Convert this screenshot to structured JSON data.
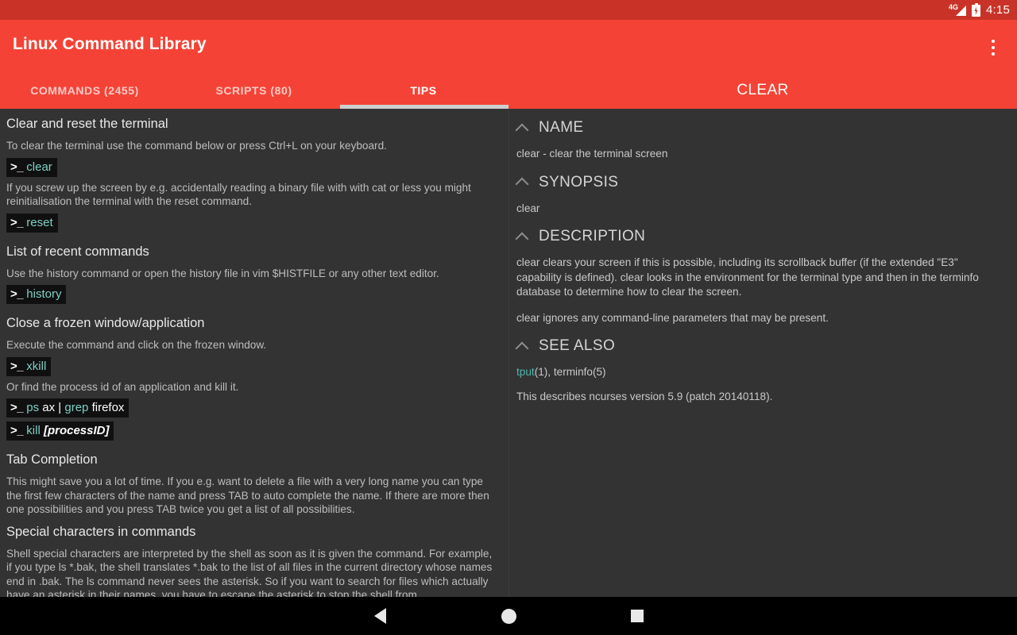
{
  "status_bar": {
    "network_label": "4G",
    "network_icon": "signal-triangle-icon",
    "battery_icon": "battery-charging-icon",
    "time": "4:15"
  },
  "app_bar": {
    "title": "Linux Command Library",
    "overflow_icon": "overflow-menu-icon",
    "background_color": "#f44336"
  },
  "tabs": [
    {
      "label": "COMMANDS (2455)",
      "active": false
    },
    {
      "label": "SCRIPTS (80)",
      "active": false
    },
    {
      "label": "TIPS",
      "active": true
    }
  ],
  "detail_pane_title": "CLEAR",
  "tips": [
    {
      "title": "Clear and reset the terminal",
      "blocks": [
        {
          "type": "text",
          "text": "To clear the terminal use the command below or press Ctrl+L on your keyboard."
        },
        {
          "type": "command",
          "prompt": ">_",
          "parts": [
            {
              "t": "clear",
              "style": "kw"
            }
          ]
        },
        {
          "type": "text",
          "text": "If you screw up the screen by e.g. accidentally reading a binary file with with cat or less you might reinitialisation the terminal with the reset command."
        },
        {
          "type": "command",
          "prompt": ">_",
          "parts": [
            {
              "t": "reset",
              "style": "kw"
            }
          ]
        }
      ]
    },
    {
      "title": "List of recent commands",
      "blocks": [
        {
          "type": "text",
          "text": "Use the history command or open the history file in vim $HISTFILE or any other text editor."
        },
        {
          "type": "command",
          "prompt": ">_",
          "parts": [
            {
              "t": "history",
              "style": "kw"
            }
          ]
        }
      ]
    },
    {
      "title": "Close a frozen window/application",
      "blocks": [
        {
          "type": "text",
          "text": "Execute the command and click on the frozen window."
        },
        {
          "type": "command",
          "prompt": ">_",
          "parts": [
            {
              "t": "xkill",
              "style": "kw"
            }
          ]
        },
        {
          "type": "text",
          "text": "Or find the process id of an application and kill it."
        },
        {
          "type": "command",
          "prompt": ">_",
          "parts": [
            {
              "t": "ps",
              "style": "kw"
            },
            {
              "t": " ax | ",
              "style": "arg"
            },
            {
              "t": "grep",
              "style": "kw"
            },
            {
              "t": " firefox",
              "style": "arg"
            }
          ]
        },
        {
          "type": "command",
          "prompt": ">_",
          "parts": [
            {
              "t": "kill",
              "style": "kw"
            },
            {
              "t": " ",
              "style": "arg"
            },
            {
              "t": "[processID]",
              "style": "ital"
            }
          ]
        }
      ]
    },
    {
      "title": "Tab Completion",
      "blocks": [
        {
          "type": "text",
          "text": "This might save you a lot of time. If you e.g. want to delete a file with a very long name you can type the first few characters of the name and press TAB to auto complete the name. If there are more then one possibilities and you press TAB twice you get a list of all possibilities."
        }
      ]
    },
    {
      "title": "Special characters in commands",
      "blocks": [
        {
          "type": "text",
          "text": "Shell special characters are interpreted by the shell as soon as it is given the command. For example, if you type ls *.bak, the shell translates *.bak to the list of all files in the current directory whose names end in .bak. The ls command never sees the asterisk. So if you want to search for files which actually have an asterisk in their names, you have to escape the asterisk to stop the shell from"
        }
      ]
    }
  ],
  "detail_sections": [
    {
      "heading": "NAME",
      "caret_icon": "chevron-up-icon",
      "paragraphs": [
        "clear - clear the terminal screen"
      ]
    },
    {
      "heading": "SYNOPSIS",
      "caret_icon": "chevron-up-icon",
      "paragraphs": [
        "clear"
      ]
    },
    {
      "heading": "DESCRIPTION",
      "caret_icon": "chevron-up-icon",
      "paragraphs": [
        "clear clears your screen if this is possible, including its scrollback buffer (if the extended \"E3\" capability is defined). clear looks in the environment for the terminal type and then in the terminfo database to determine how to clear the screen.",
        "clear ignores any command-line parameters that may be present."
      ]
    },
    {
      "heading": "SEE ALSO",
      "caret_icon": "chevron-up-icon",
      "see_also": {
        "link": "tput",
        "rest": "(1), terminfo(5)"
      },
      "paragraphs": [
        "This describes ncurses version 5.9 (patch 20140118)."
      ]
    }
  ],
  "nav_bar": {
    "back_icon": "back-triangle-icon",
    "home_icon": "home-circle-icon",
    "recents_icon": "recents-square-icon"
  },
  "colors": {
    "accent": "#f44336",
    "status_bar": "#c93327",
    "background": "#333333",
    "command_chip_bg": "#101010",
    "keyword": "#7fcfc4",
    "link": "#4db6ac"
  }
}
